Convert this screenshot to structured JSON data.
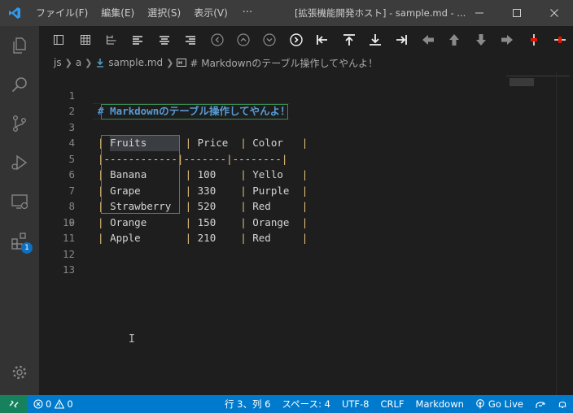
{
  "titlebar": {
    "menu": [
      "ファイル(F)",
      "編集(E)",
      "選択(S)",
      "表示(V)"
    ],
    "more": "···",
    "title": "[拡張機能開発ホスト] - sample.md - ...",
    "icons": [
      "vscode-logo-icon",
      "minimize-icon",
      "restore-icon",
      "close-icon"
    ]
  },
  "activitybar": {
    "items": [
      "explorer-icon",
      "search-icon",
      "source-control-icon",
      "run-debug-icon",
      "remote-explorer-icon",
      "extensions-icon"
    ],
    "extensions_badge": "1",
    "bottom": "manage-gear-icon"
  },
  "toolbar": {
    "buttons": [
      "format-table-icon",
      "table-grid-icon",
      "table-column-icon",
      "align-left-icon",
      "align-center-icon",
      "align-right-icon",
      "circle-left-icon",
      "circle-up-icon",
      "circle-down-icon",
      "circle-right-icon",
      "move-to-start-icon",
      "move-to-top-icon",
      "move-to-bottom-icon",
      "move-to-end-icon",
      "arrow-left-icon",
      "arrow-up-icon",
      "arrow-down-icon",
      "arrow-right-icon",
      "insert-column-icon",
      "insert-row-icon"
    ]
  },
  "breadcrumb": {
    "items": [
      "js",
      "a",
      "sample.md",
      "# Markdownのテーブル操作してやんよ！"
    ]
  },
  "editor": {
    "line_numbers": [
      "1",
      "2",
      "3",
      "4",
      "5",
      "6",
      "7",
      "8",
      "9",
      "10",
      "11",
      "12",
      "13"
    ],
    "heading": "# Markdownのテーブル操作してやんよ！",
    "table": {
      "headers": [
        "Fruits",
        "Price",
        "Color"
      ],
      "separator": [
        "------------",
        "-------",
        "--------"
      ],
      "rows": [
        [
          "Banana",
          "100",
          "Yello"
        ],
        [
          "Grape",
          "330",
          "Purple"
        ],
        [
          "Strawberry",
          "520",
          "Red"
        ],
        [
          "Orange",
          "150",
          "Orange"
        ],
        [
          "Apple",
          "210",
          "Red"
        ]
      ],
      "pipe": "|"
    },
    "pointer": "I"
  },
  "statusbar": {
    "errors": "0",
    "warnings": "0",
    "position": "行 3、列 6",
    "spaces": "スペース: 4",
    "encoding": "UTF-8",
    "eol": "CRLF",
    "language": "Markdown",
    "golive": "Go Live"
  },
  "colors": {
    "accent": "#007acc",
    "remote": "#16825d",
    "heading": "#569cd6",
    "pipe": "#e5c07b",
    "selection_border": "#3c8a52"
  }
}
